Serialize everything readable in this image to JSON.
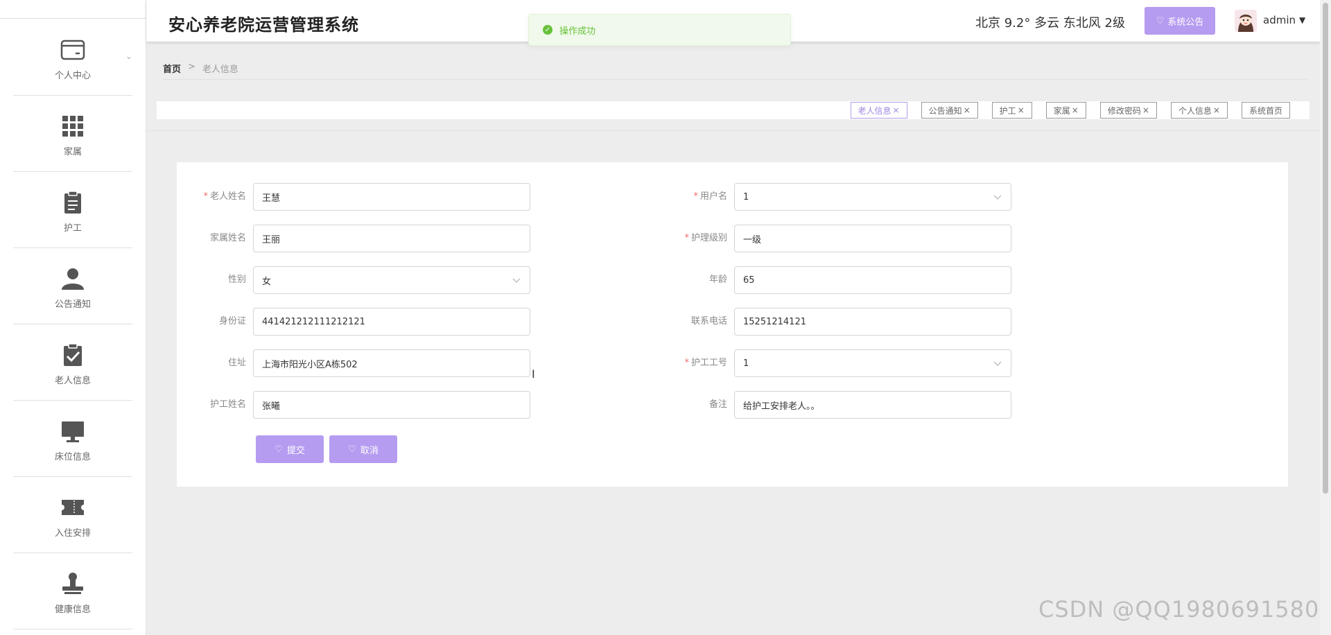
{
  "app": {
    "title": "安心养老院运营管理系统"
  },
  "header": {
    "weather": "北京  9.2° 多云  东北风  2级",
    "notice_button": "系统公告",
    "username": "admin"
  },
  "toast": {
    "message": "操作成功"
  },
  "sidebar": {
    "items": [
      {
        "label": "个人中心",
        "icon": "card-icon"
      },
      {
        "label": "家属",
        "icon": "grid-icon"
      },
      {
        "label": "护工",
        "icon": "clipboard-icon"
      },
      {
        "label": "公告通知",
        "icon": "user-icon"
      },
      {
        "label": "老人信息",
        "icon": "clipboard-check-icon"
      },
      {
        "label": "床位信息",
        "icon": "monitor-icon"
      },
      {
        "label": "入住安排",
        "icon": "ticket-icon"
      },
      {
        "label": "健康信息",
        "icon": "stamp-icon"
      }
    ]
  },
  "breadcrumb": {
    "home": "首页",
    "separator": ">",
    "current": "老人信息"
  },
  "tags": [
    {
      "label": "老人信息",
      "close": "×",
      "active": true
    },
    {
      "label": "公告通知",
      "close": "×"
    },
    {
      "label": "护工",
      "close": "×"
    },
    {
      "label": "家属",
      "close": "×"
    },
    {
      "label": "修改密码",
      "close": "×"
    },
    {
      "label": "个人信息",
      "close": "×"
    },
    {
      "label": "系统首页",
      "close": ""
    }
  ],
  "form": {
    "elder_name": {
      "label": "老人姓名",
      "value": "王慧",
      "required": true
    },
    "family_name": {
      "label": "家属姓名",
      "value": "王丽"
    },
    "gender": {
      "label": "性别",
      "value": "女"
    },
    "id_card": {
      "label": "身份证",
      "value": "441421212111212121"
    },
    "address": {
      "label": "住址",
      "value": "上海市阳光小区A栋502"
    },
    "carer_name": {
      "label": "护工姓名",
      "value": "张曦"
    },
    "username": {
      "label": "用户名",
      "value": "1",
      "required": true
    },
    "care_level": {
      "label": "护理级别",
      "value": "一级",
      "required": true
    },
    "age": {
      "label": "年龄",
      "value": "65"
    },
    "phone": {
      "label": "联系电话",
      "value": "15251214121"
    },
    "carer_id": {
      "label": "护工工号",
      "value": "1",
      "required": true
    },
    "remark": {
      "label": "备注",
      "value": "给护工安排老人。。"
    },
    "submit": "提交",
    "cancel": "取消"
  },
  "watermark": "CSDN @QQ1980691580",
  "colors": {
    "accent": "#b59cf0",
    "success": "#67c23a",
    "required": "#f56c6c"
  }
}
